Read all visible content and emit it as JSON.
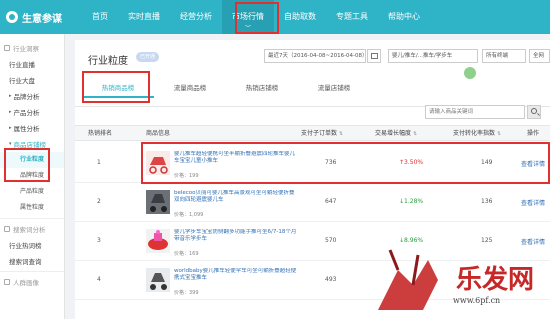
{
  "app": {
    "title": "生意参谋"
  },
  "nav": [
    "首页",
    "实时直播",
    "经营分析",
    "市场行情",
    "自助取数",
    "专题工具",
    "帮助中心"
  ],
  "sidebar": {
    "group1": "行业洞察",
    "items": [
      "行业直播",
      "行业大盘",
      "品牌分析",
      "产品分析",
      "属性分析",
      "商品店铺榜"
    ],
    "subitems": [
      "行业粒度",
      "品牌粒度",
      "产品粒度",
      "属性粒度"
    ],
    "group2": "搜索词分析",
    "items2": [
      "行业热词榜",
      "搜索词查询"
    ],
    "group3": "人群画像"
  },
  "header": {
    "title": "行业粒度",
    "badge": "已开通",
    "date_range": "最近7天（2016-04-08~2016-04-08）",
    "category": "婴儿/推车/...推车/学步车",
    "terminal": "所有终端",
    "all": "全网"
  },
  "tabs": [
    "热销商品榜",
    "流量商品榜",
    "热销店铺榜",
    "流量店铺榜"
  ],
  "search": {
    "placeholder": "请输入商品关键词"
  },
  "table": {
    "headers": [
      "热销排名",
      "商品信息",
      "支付子订单数",
      "交易增长幅度",
      "支付转化率指数",
      "操作"
    ],
    "rows": [
      {
        "rank": "1",
        "name": "婴儿推车超轻便携可坐半躺折叠避震四轮推车婴儿车宝宝儿童小推车",
        "price": "价格：199",
        "orders": "736",
        "growth": "3.50%",
        "growth_dir": "up",
        "conv": "149",
        "action": "查看详情"
      },
      {
        "rank": "2",
        "name": "belecoo贝丽可婴儿推车高景观可坐可躺轻便折叠双向四轮避震婴儿车",
        "price": "价格：1,099",
        "orders": "647",
        "growth": "1.28%",
        "growth_dir": "up",
        "conv": "136",
        "action": "查看详情"
      },
      {
        "rank": "3",
        "name": "婴儿学步车宝宝防侧翻多功能手推可坐6/7-18个月带音乐学步车",
        "price": "价格：169",
        "orders": "570",
        "growth": "8.96%",
        "growth_dir": "up",
        "conv": "125",
        "action": "查看详情"
      },
      {
        "rank": "4",
        "name": "worldbaby婴儿推车轻便伞车可坐可躺折叠超轻便携式宝宝推车",
        "price": "价格：399",
        "orders": "493",
        "growth": "",
        "growth_dir": "up",
        "conv": "",
        "action": ""
      }
    ]
  },
  "watermark": {
    "text": "乐发网",
    "url": "www.6pf.cn"
  },
  "colors": {
    "nav_bg": "#2fb3c7",
    "highlight": "#e03030",
    "link": "#2f6fb5"
  }
}
